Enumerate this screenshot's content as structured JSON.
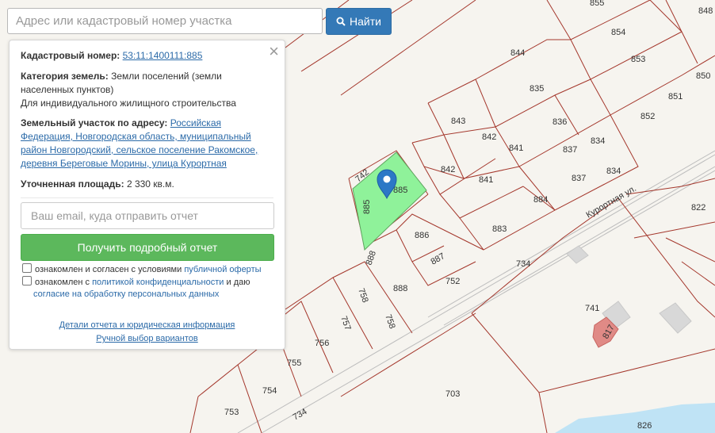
{
  "search": {
    "placeholder": "Адрес или кадастровый номер участка",
    "button_label": "Найти"
  },
  "panel": {
    "cadastral_label": "Кадастровый номер:",
    "cadastral_value": "53:11:1400111:885",
    "category_label": "Категория земель:",
    "category_value_1": "Земли поселений (земли",
    "category_value_2": "населенных пунктов)",
    "category_use": "Для индивидуального жилищного строительства",
    "address_label": "Земельный участок по адресу:",
    "address_lines": [
      "Российская",
      "Федерация, Новгородская область, муниципальный",
      "район Новгородский, сельское поселение Ракомское,",
      "деревня Береговые Морины, улица Курортная"
    ],
    "area_label": "Уточненная площадь:",
    "area_value": "2 330 кв.м.",
    "email_placeholder": "Ваш email, куда отправить отчет",
    "report_button": "Получить подробный отчет",
    "consent1_text": "ознакомлен и согласен с условиями",
    "consent1_link": "публичной оферты",
    "consent2_text": "ознакомлен с",
    "consent2_link": "политикой конфиденциальности",
    "consent2_mid": "и даю",
    "consent2_link2": "согласие на обработку персональных данных",
    "details_link": "Детали отчета и юридическая информация",
    "manual_link": "Ручной выбор вариантов"
  },
  "map": {
    "street_label": "Курортная ул.",
    "highlight_color": "#8ff29a",
    "boundary_color": "#a4372c",
    "road_color": "#bdbdbd",
    "marker_color": "#2c78c6",
    "water_color": "#bfe3f5",
    "building_color": "#d8d8d8",
    "parcel_labels": [
      "855",
      "848",
      "844",
      "854",
      "853",
      "850",
      "835",
      "851",
      "836",
      "852",
      "843",
      "842",
      "841",
      "837",
      "834",
      "842",
      "841",
      "837",
      "834",
      "884",
      "822",
      "883",
      "886",
      "887",
      "752",
      "734",
      "888",
      "758",
      "758",
      "757",
      "756",
      "755",
      "754",
      "753",
      "734",
      "703",
      "741",
      "817",
      "826",
      "742",
      "885",
      "885",
      "888"
    ]
  }
}
